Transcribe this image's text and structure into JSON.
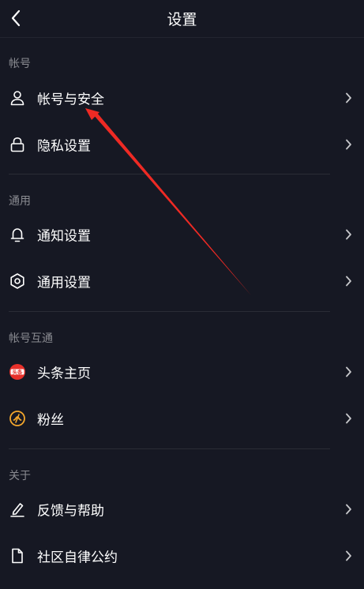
{
  "header": {
    "title": "设置"
  },
  "sections": [
    {
      "label": "帐号",
      "items": [
        {
          "label": "帐号与安全",
          "icon": "user-icon"
        },
        {
          "label": "隐私设置",
          "icon": "lock-icon"
        }
      ]
    },
    {
      "label": "通用",
      "items": [
        {
          "label": "通知设置",
          "icon": "bell-icon"
        },
        {
          "label": "通用设置",
          "icon": "gear-icon"
        }
      ]
    },
    {
      "label": "帐号互通",
      "items": [
        {
          "label": "头条主页",
          "icon": "toutiao-icon",
          "icon_text": "头条"
        },
        {
          "label": "粉丝",
          "icon": "fans-icon"
        }
      ]
    },
    {
      "label": "关于",
      "items": [
        {
          "label": "反馈与帮助",
          "icon": "edit-icon"
        },
        {
          "label": "社区自律公约",
          "icon": "document-icon"
        }
      ]
    }
  ],
  "colors": {
    "background": "#161823",
    "annotation_arrow": "#ee2a24",
    "toutiao_brand": "#e8312b",
    "fans_brand": "#f4a72c"
  }
}
